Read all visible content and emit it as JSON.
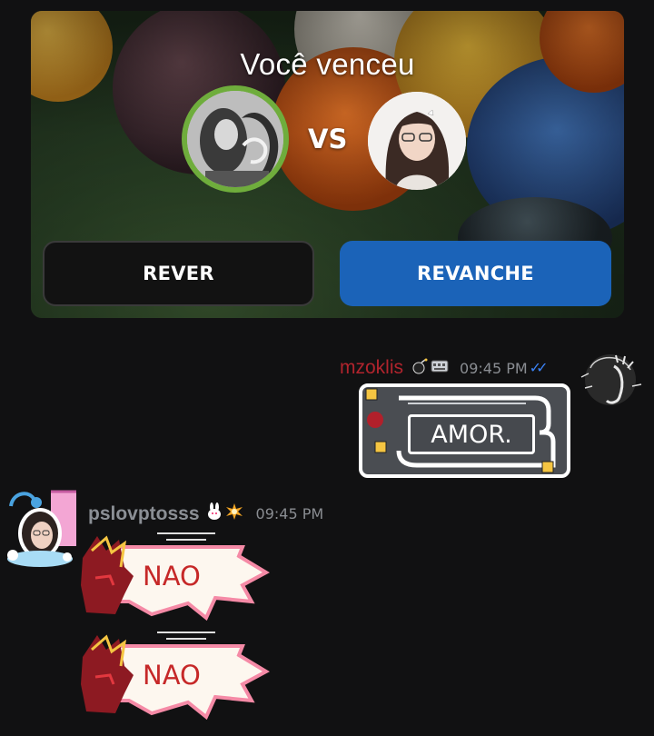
{
  "game": {
    "title": "Você venceu",
    "vs_label": "VS",
    "left_player": {
      "winner": true,
      "ring_color": "#6fad3c"
    },
    "right_player": {
      "winner": false
    },
    "buttons": {
      "rever": "REVER",
      "revanche": "REVANCHE"
    },
    "colors": {
      "revanche": "#1b63b8",
      "rever": "#121212"
    }
  },
  "messages": [
    {
      "username": "mzoklis",
      "username_color": "#b1242d",
      "time": "09:45 PM",
      "read": true,
      "sticker_text": "AMOR."
    },
    {
      "username": "pslovptosss",
      "username_color": "#8b8f95",
      "time": "09:45 PM",
      "stickers": [
        "NAO",
        "NAO"
      ]
    }
  ],
  "icons": {
    "read_receipt": "double-check-icon",
    "badges": [
      "bomb-badge-icon",
      "keyboard-badge-icon",
      "bunny-badge-icon",
      "explosion-badge-icon"
    ]
  }
}
